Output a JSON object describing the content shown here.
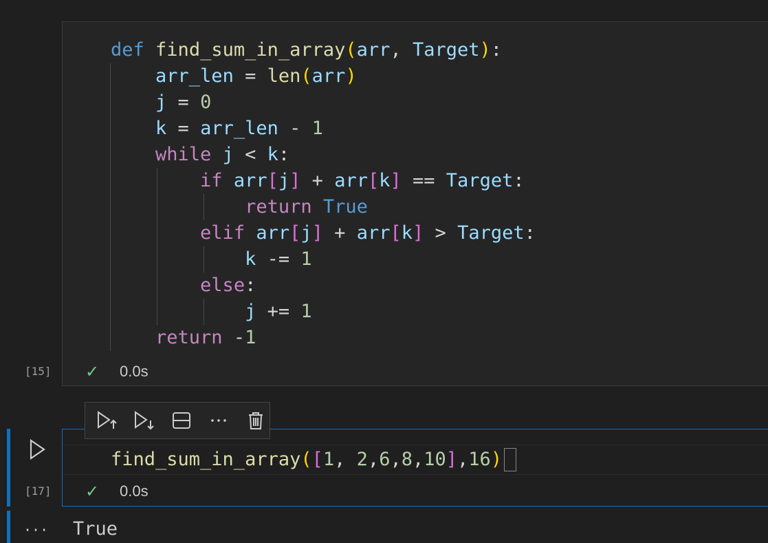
{
  "cell1": {
    "exec_count": "[15]",
    "status_time": "0.0s",
    "code": [
      [
        [
          "kw",
          "def"
        ],
        [
          "op",
          " "
        ],
        [
          "fn",
          "find_sum_in_array"
        ],
        [
          "br1",
          "("
        ],
        [
          "var",
          "arr"
        ],
        [
          "op",
          ", "
        ],
        [
          "var",
          "Target"
        ],
        [
          "br1",
          ")"
        ],
        [
          "op",
          ":"
        ]
      ],
      [
        [
          "op",
          "    "
        ],
        [
          "var",
          "arr_len"
        ],
        [
          "op",
          " = "
        ],
        [
          "fn",
          "len"
        ],
        [
          "br1",
          "("
        ],
        [
          "var",
          "arr"
        ],
        [
          "br1",
          ")"
        ]
      ],
      [
        [
          "op",
          "    "
        ],
        [
          "var",
          "j"
        ],
        [
          "op",
          " = "
        ],
        [
          "num",
          "0"
        ]
      ],
      [
        [
          "op",
          "    "
        ],
        [
          "var",
          "k"
        ],
        [
          "op",
          " = "
        ],
        [
          "var",
          "arr_len"
        ],
        [
          "op",
          " - "
        ],
        [
          "num",
          "1"
        ]
      ],
      [
        [
          "op",
          "    "
        ],
        [
          "ctl",
          "while"
        ],
        [
          "op",
          " "
        ],
        [
          "var",
          "j"
        ],
        [
          "op",
          " < "
        ],
        [
          "var",
          "k"
        ],
        [
          "op",
          ":"
        ]
      ],
      [
        [
          "op",
          "        "
        ],
        [
          "ctl",
          "if"
        ],
        [
          "op",
          " "
        ],
        [
          "var",
          "arr"
        ],
        [
          "br2",
          "["
        ],
        [
          "var",
          "j"
        ],
        [
          "br2",
          "]"
        ],
        [
          "op",
          " + "
        ],
        [
          "var",
          "arr"
        ],
        [
          "br2",
          "["
        ],
        [
          "var",
          "k"
        ],
        [
          "br2",
          "]"
        ],
        [
          "op",
          " == "
        ],
        [
          "var",
          "Target"
        ],
        [
          "op",
          ":"
        ]
      ],
      [
        [
          "op",
          "            "
        ],
        [
          "ctl",
          "return"
        ],
        [
          "op",
          " "
        ],
        [
          "kw",
          "True"
        ]
      ],
      [
        [
          "op",
          "        "
        ],
        [
          "ctl",
          "elif"
        ],
        [
          "op",
          " "
        ],
        [
          "var",
          "arr"
        ],
        [
          "br2",
          "["
        ],
        [
          "var",
          "j"
        ],
        [
          "br2",
          "]"
        ],
        [
          "op",
          " + "
        ],
        [
          "var",
          "arr"
        ],
        [
          "br2",
          "["
        ],
        [
          "var",
          "k"
        ],
        [
          "br2",
          "]"
        ],
        [
          "op",
          " > "
        ],
        [
          "var",
          "Target"
        ],
        [
          "op",
          ":"
        ]
      ],
      [
        [
          "op",
          "            "
        ],
        [
          "var",
          "k"
        ],
        [
          "op",
          " -= "
        ],
        [
          "num",
          "1"
        ]
      ],
      [
        [
          "op",
          "        "
        ],
        [
          "ctl",
          "else"
        ],
        [
          "op",
          ":"
        ]
      ],
      [
        [
          "op",
          "            "
        ],
        [
          "var",
          "j"
        ],
        [
          "op",
          " += "
        ],
        [
          "num",
          "1"
        ]
      ],
      [
        [
          "op",
          "    "
        ],
        [
          "ctl",
          "return"
        ],
        [
          "op",
          " -"
        ],
        [
          "num",
          "1"
        ]
      ]
    ]
  },
  "cell2": {
    "exec_count": "[17]",
    "status_time": "0.0s",
    "code": [
      [
        [
          "fn",
          "find_sum_in_array"
        ],
        [
          "br1",
          "("
        ],
        [
          "br2",
          "["
        ],
        [
          "num",
          "1"
        ],
        [
          "op",
          ", "
        ],
        [
          "num",
          "2"
        ],
        [
          "op",
          ","
        ],
        [
          "num",
          "6"
        ],
        [
          "op",
          ","
        ],
        [
          "num",
          "8"
        ],
        [
          "op",
          ","
        ],
        [
          "num",
          "10"
        ],
        [
          "br2",
          "]"
        ],
        [
          "op",
          ","
        ],
        [
          "num",
          "16"
        ],
        [
          "br1",
          ")"
        ]
      ]
    ]
  },
  "output": {
    "text": "True",
    "more_label": "···"
  },
  "colors": {
    "accent": "#0e70c0",
    "success": "#73c991",
    "keyword": "#569cd6",
    "control": "#c586c0",
    "function": "#dcdcaa",
    "variable": "#9cdcfe",
    "number": "#b5cea8"
  },
  "toolbar": {
    "icons": [
      "execute-above-icon",
      "execute-below-icon",
      "split-cell-icon",
      "more-icon",
      "delete-icon"
    ]
  }
}
